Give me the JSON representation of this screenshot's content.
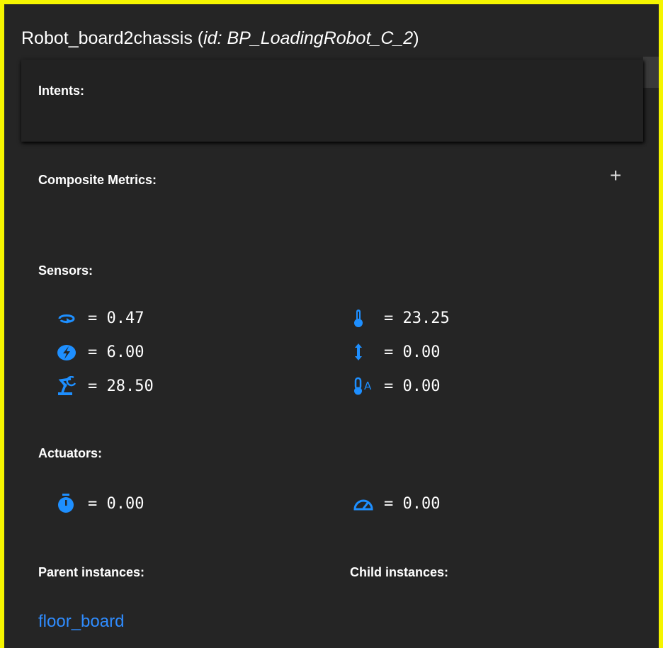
{
  "header": {
    "title_name": "Robot_board2chassis",
    "title_open": " (",
    "title_id_label": "id:",
    "title_id_value": "BP_LoadingRobot_C_2",
    "title_close": ")"
  },
  "intents": {
    "label": "Intents:"
  },
  "composite_metrics": {
    "label": "Composite Metrics:",
    "add_symbol": "+"
  },
  "sensors": {
    "label": "Sensors:",
    "items": [
      {
        "icon": "rotation-icon",
        "text": "= 0.47"
      },
      {
        "icon": "thermometer-icon",
        "text": "= 23.25"
      },
      {
        "icon": "energy-icon",
        "text": "= 6.00"
      },
      {
        "icon": "vertical-arrow-icon",
        "text": "= 0.00"
      },
      {
        "icon": "robot-arm-icon",
        "text": "= 28.50"
      },
      {
        "icon": "ambient-temperature-icon",
        "text": "= 0.00"
      }
    ]
  },
  "actuators": {
    "label": "Actuators:",
    "items": [
      {
        "icon": "stopwatch-icon",
        "text": "= 0.00"
      },
      {
        "icon": "speedometer-icon",
        "text": "= 0.00"
      }
    ]
  },
  "relations": {
    "parent_label": "Parent instances:",
    "child_label": "Child instances:",
    "parents": [
      "floor_board"
    ]
  },
  "colors": {
    "border": "#f5f500",
    "panel_bg": "#252525",
    "icon_blue": "#1e8fff",
    "link_blue": "#2f8cff"
  }
}
